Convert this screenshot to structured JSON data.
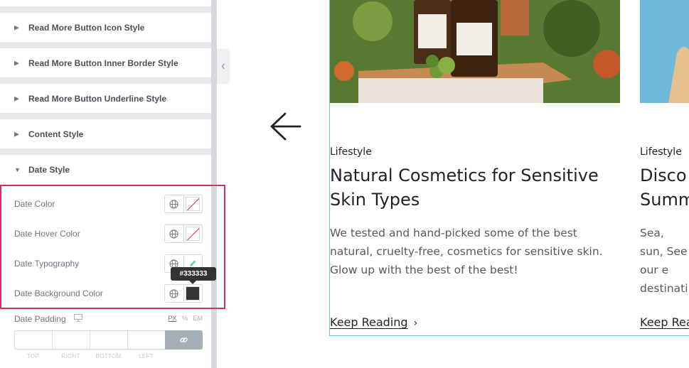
{
  "panel": {
    "sections": [
      {
        "label": "Read More Button Icon Style"
      },
      {
        "label": "Read More Button Inner Border Style"
      },
      {
        "label": "Read More Button Underline Style"
      },
      {
        "label": "Content Style"
      },
      {
        "label": "Date Style",
        "expanded": true
      }
    ],
    "controls": [
      {
        "label": "Date Color",
        "swatch": "empty"
      },
      {
        "label": "Date Hover Color",
        "swatch": "empty"
      },
      {
        "label": "Date Typography",
        "swatch": "pencil"
      },
      {
        "label": "Date Background Color",
        "swatch": "filled",
        "color": "#333333"
      }
    ],
    "tooltip": "#333333",
    "padding": {
      "label": "Date Padding",
      "units": [
        "PX",
        "%",
        "EM"
      ],
      "active_unit": "PX",
      "fields": [
        "TOP",
        "RIGHT",
        "BOTTOM",
        "LEFT"
      ]
    }
  },
  "preview": {
    "cards": [
      {
        "category": "Lifestyle",
        "title": "Natural Cosmetics for Sensitive Skin Types",
        "excerpt": "We tested and hand-picked some of the best natural, cruelty-free, cosmetics for sensitive skin. Glow up with the best of the best!",
        "read_more": "Keep Reading"
      },
      {
        "category": "Lifestyle",
        "title": "Disco Summ",
        "excerpt": "Sea, sun, See our e destinati",
        "read_more": "Keep Rea"
      }
    ]
  },
  "colors": {
    "highlight": "#d0325d",
    "accent_border": "#5bc8d6",
    "link_button": "#a4afb7"
  }
}
